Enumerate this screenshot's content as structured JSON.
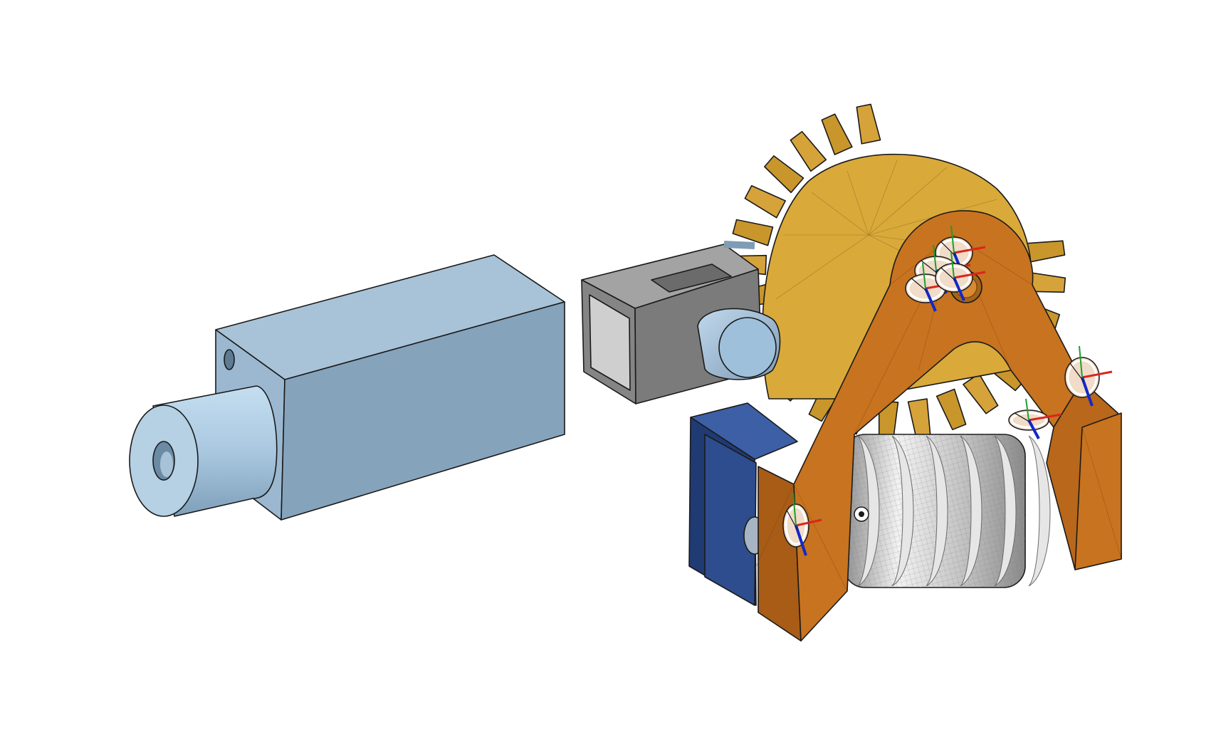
{
  "viewport": {
    "background": "#ffffff"
  },
  "parts": {
    "motor": {
      "colors": {
        "front": "#8aa6be",
        "top": "#a8c3d8",
        "side": "#9bb8d0",
        "shaft": "#b4d2ea"
      }
    },
    "coupler": {
      "colors": {
        "front": "#7d7d7d",
        "top": "#9a9a9a",
        "side": "#8c8c8c",
        "pin": "#9dbcd6"
      }
    },
    "gear": {
      "colors": {
        "face": "#d9a93a",
        "teeth": "#c9962c",
        "hub": "#b57d1f"
      }
    },
    "frame": {
      "colors": {
        "front": "#c8731f",
        "side": "#a85c16",
        "top": "#d68a3a"
      }
    },
    "block": {
      "colors": {
        "front": "#2e4d8f",
        "side": "#203a73",
        "top": "#3d5fa6"
      }
    },
    "worm": {
      "colors": {
        "body": "#bfbfbf",
        "thread": "#e6e6e6",
        "shade": "#9a9a9a"
      }
    },
    "mate_connectors": {
      "colors": {
        "x_axis": "#d9261c",
        "y_axis": "#1e9e2e",
        "z_axis": "#1228c8",
        "ring": "#ffffff",
        "fill": "#f0dcc8"
      }
    }
  }
}
